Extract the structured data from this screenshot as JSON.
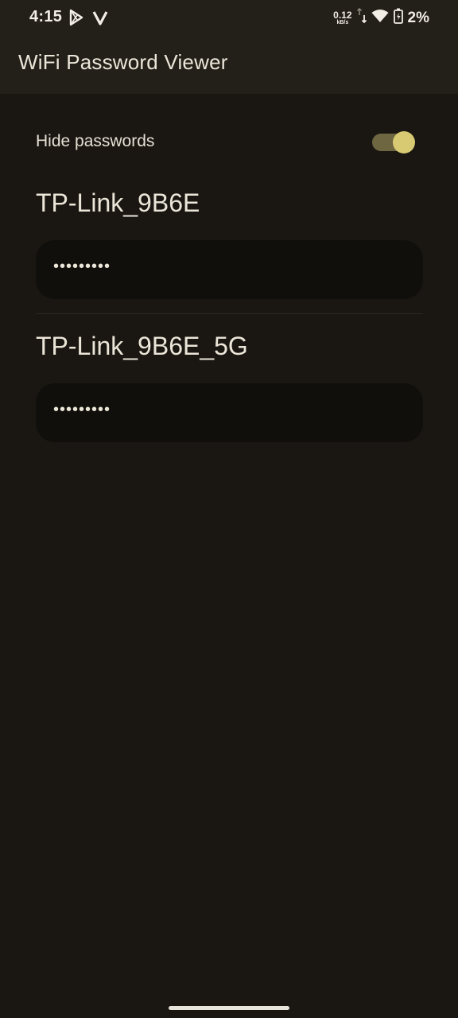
{
  "status_bar": {
    "time": "4:15",
    "left_icons": [
      "play-store-icon",
      "v-app-icon"
    ],
    "net_speed_value": "0.12",
    "net_speed_unit": "kB/s",
    "right_icons": [
      "data-transfer-icon",
      "wifi-icon",
      "battery-charging-icon"
    ],
    "battery_percent": "2%"
  },
  "app_bar": {
    "title": "WiFi Password Viewer"
  },
  "settings": {
    "hide_passwords_label": "Hide passwords",
    "hide_passwords_enabled": true
  },
  "networks": [
    {
      "name": "TP-Link_9B6E",
      "password_display": "•••••••••"
    },
    {
      "name": "TP-Link_9B6E_5G",
      "password_display": "•••••••••"
    }
  ],
  "colors": {
    "background": "#1a1712",
    "app_bar": "#232019",
    "accent": "#d8c973",
    "field": "#110f0b"
  }
}
